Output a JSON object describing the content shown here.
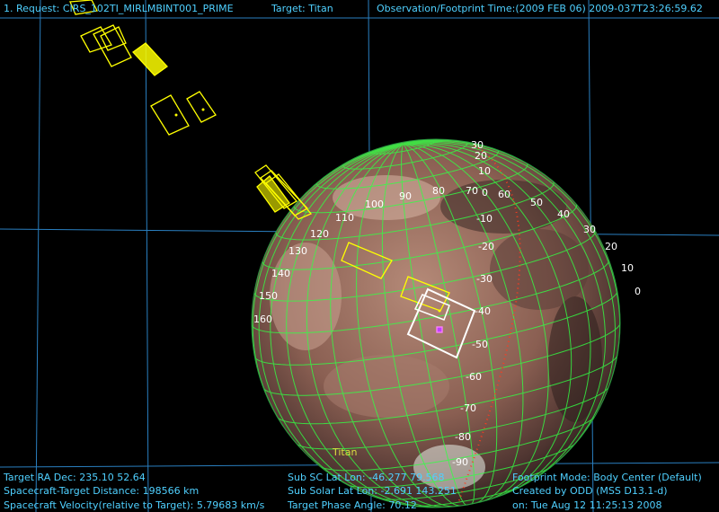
{
  "header": {
    "request": "1. Request: CIRS_102TI_MIRLMBINT001_PRIME",
    "target": "Target: Titan",
    "time": "Observation/Footprint Time:(2009 FEB 06) 2009-037T23:26:59.62"
  },
  "footer": {
    "ra_dec": "Target RA Dec: 235.10  52.64",
    "distance": "Spacecraft-Target Distance:  198566 km",
    "velocity": "Spacecraft Velocity(relative to Target): 5.79683 km/s",
    "sub_sc": "Sub SC Lat Lon: -46.277  79.568",
    "sub_solar": "Sub Solar Lat Lon: -2.691  143.251",
    "phase": "Target Phase Angle: 70.12",
    "mode": "Footprint Mode: Body Center (Default)",
    "created": "Created by ODD (MSS D13.1-d)",
    "date": "on: Tue Aug 12 11:25:13 2008"
  },
  "body_label": "Titan",
  "lon_labels": [
    "0",
    "10",
    "20",
    "30",
    "40",
    "50",
    "60",
    "70",
    "80",
    "90",
    "100",
    "110",
    "120",
    "130",
    "140",
    "150",
    "160"
  ],
  "lat_labels": [
    "30",
    "20",
    "10",
    "0",
    "-10",
    "-20",
    "-30",
    "-40",
    "-50",
    "-60",
    "-70",
    "-80",
    "-90"
  ],
  "colors": {
    "label_cyan": "#4fd0ff",
    "grid_blue": "#2a7fc0",
    "footprint_yellow": "#ffff00",
    "footprint_white": "#ffffff",
    "lat_lon_green": "#33ff44",
    "terminator_red": "#ff3b1f",
    "body_text": "#ffffff",
    "subsc_marker": "#c040ff"
  }
}
